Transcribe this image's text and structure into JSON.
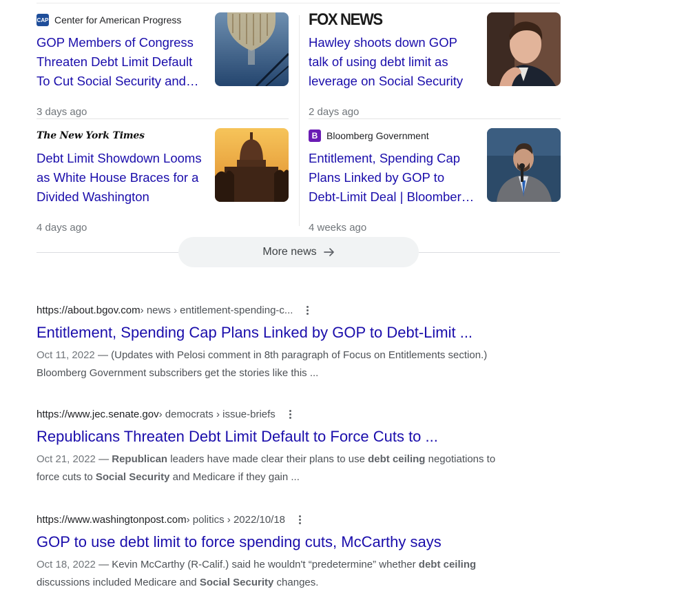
{
  "news": [
    {
      "source": "Center for American Progress",
      "source_icon": "cap-favicon-icon",
      "favicon_text": "CAP",
      "title": "GOP Members of Congress Threaten Debt Limit Default To Cut Social Security and Medicare",
      "age": "3 days ago",
      "thumbnail": "capitol-dome-reflection-image"
    },
    {
      "source": "FOX NEWS",
      "source_icon": "fox-news-logo",
      "title": "Hawley shoots down GOP talk of using debt limit as leverage on Social Security",
      "age": "2 days ago",
      "thumbnail": "josh-hawley-portrait-image"
    },
    {
      "source": "The New York Times",
      "source_icon": "nyt-logo",
      "title": "Debt Limit Showdown Looms as White House Braces for a Divided Washington",
      "age": "4 days ago",
      "thumbnail": "capitol-sunset-image"
    },
    {
      "source": "Bloomberg Government",
      "source_icon": "bloomberg-favicon-icon",
      "favicon_text": "B",
      "title": "Entitlement, Spending Cap Plans Linked by GOP to Debt-Limit Deal | Bloomberg Government",
      "age": "4 weeks ago",
      "thumbnail": "speaker-at-microphone-image"
    }
  ],
  "more_news": {
    "label": "More news",
    "icon": "arrow-right-icon"
  },
  "results": [
    {
      "url_domain": "https://about.bgov.com",
      "url_crumbs": " › news › entitlement-spending-c...",
      "title": "Entitlement, Spending Cap Plans Linked by GOP to Debt-Limit ...",
      "date": "Oct 11, 2022",
      "snippet": [
        {
          "t": "(Updates with Pelosi comment in 8th paragraph of Focus on Entitlements section.) Bloomberg Government subscribers get the stories like this ...",
          "b": false
        }
      ]
    },
    {
      "url_domain": "https://www.jec.senate.gov",
      "url_crumbs": " › democrats › issue-briefs",
      "title": "Republicans Threaten Debt Limit Default to Force Cuts to ...",
      "date": "Oct 21, 2022",
      "snippet": [
        {
          "t": "Republican",
          "b": true
        },
        {
          "t": " leaders have made clear their plans to use ",
          "b": false
        },
        {
          "t": "debt ceiling",
          "b": true
        },
        {
          "t": " negotiations to force cuts to ",
          "b": false
        },
        {
          "t": "Social Security",
          "b": true
        },
        {
          "t": " and Medicare if they gain ...",
          "b": false
        }
      ]
    },
    {
      "url_domain": "https://www.washingtonpost.com",
      "url_crumbs": " › politics › 2022/10/18",
      "title": "GOP to use debt limit to force spending cuts, McCarthy says",
      "date": "Oct 18, 2022",
      "snippet": [
        {
          "t": "Kevin McCarthy (R-Calif.) said he wouldn't “predetermine” whether ",
          "b": false
        },
        {
          "t": "debt ceiling",
          "b": true
        },
        {
          "t": " discussions included Medicare and ",
          "b": false
        },
        {
          "t": "Social Security",
          "b": true
        },
        {
          "t": " changes.",
          "b": false
        }
      ]
    }
  ],
  "colors": {
    "link": "#1a0dab",
    "meta": "#70757a",
    "snippet": "#4d5156",
    "pill_bg": "#f1f3f4"
  }
}
